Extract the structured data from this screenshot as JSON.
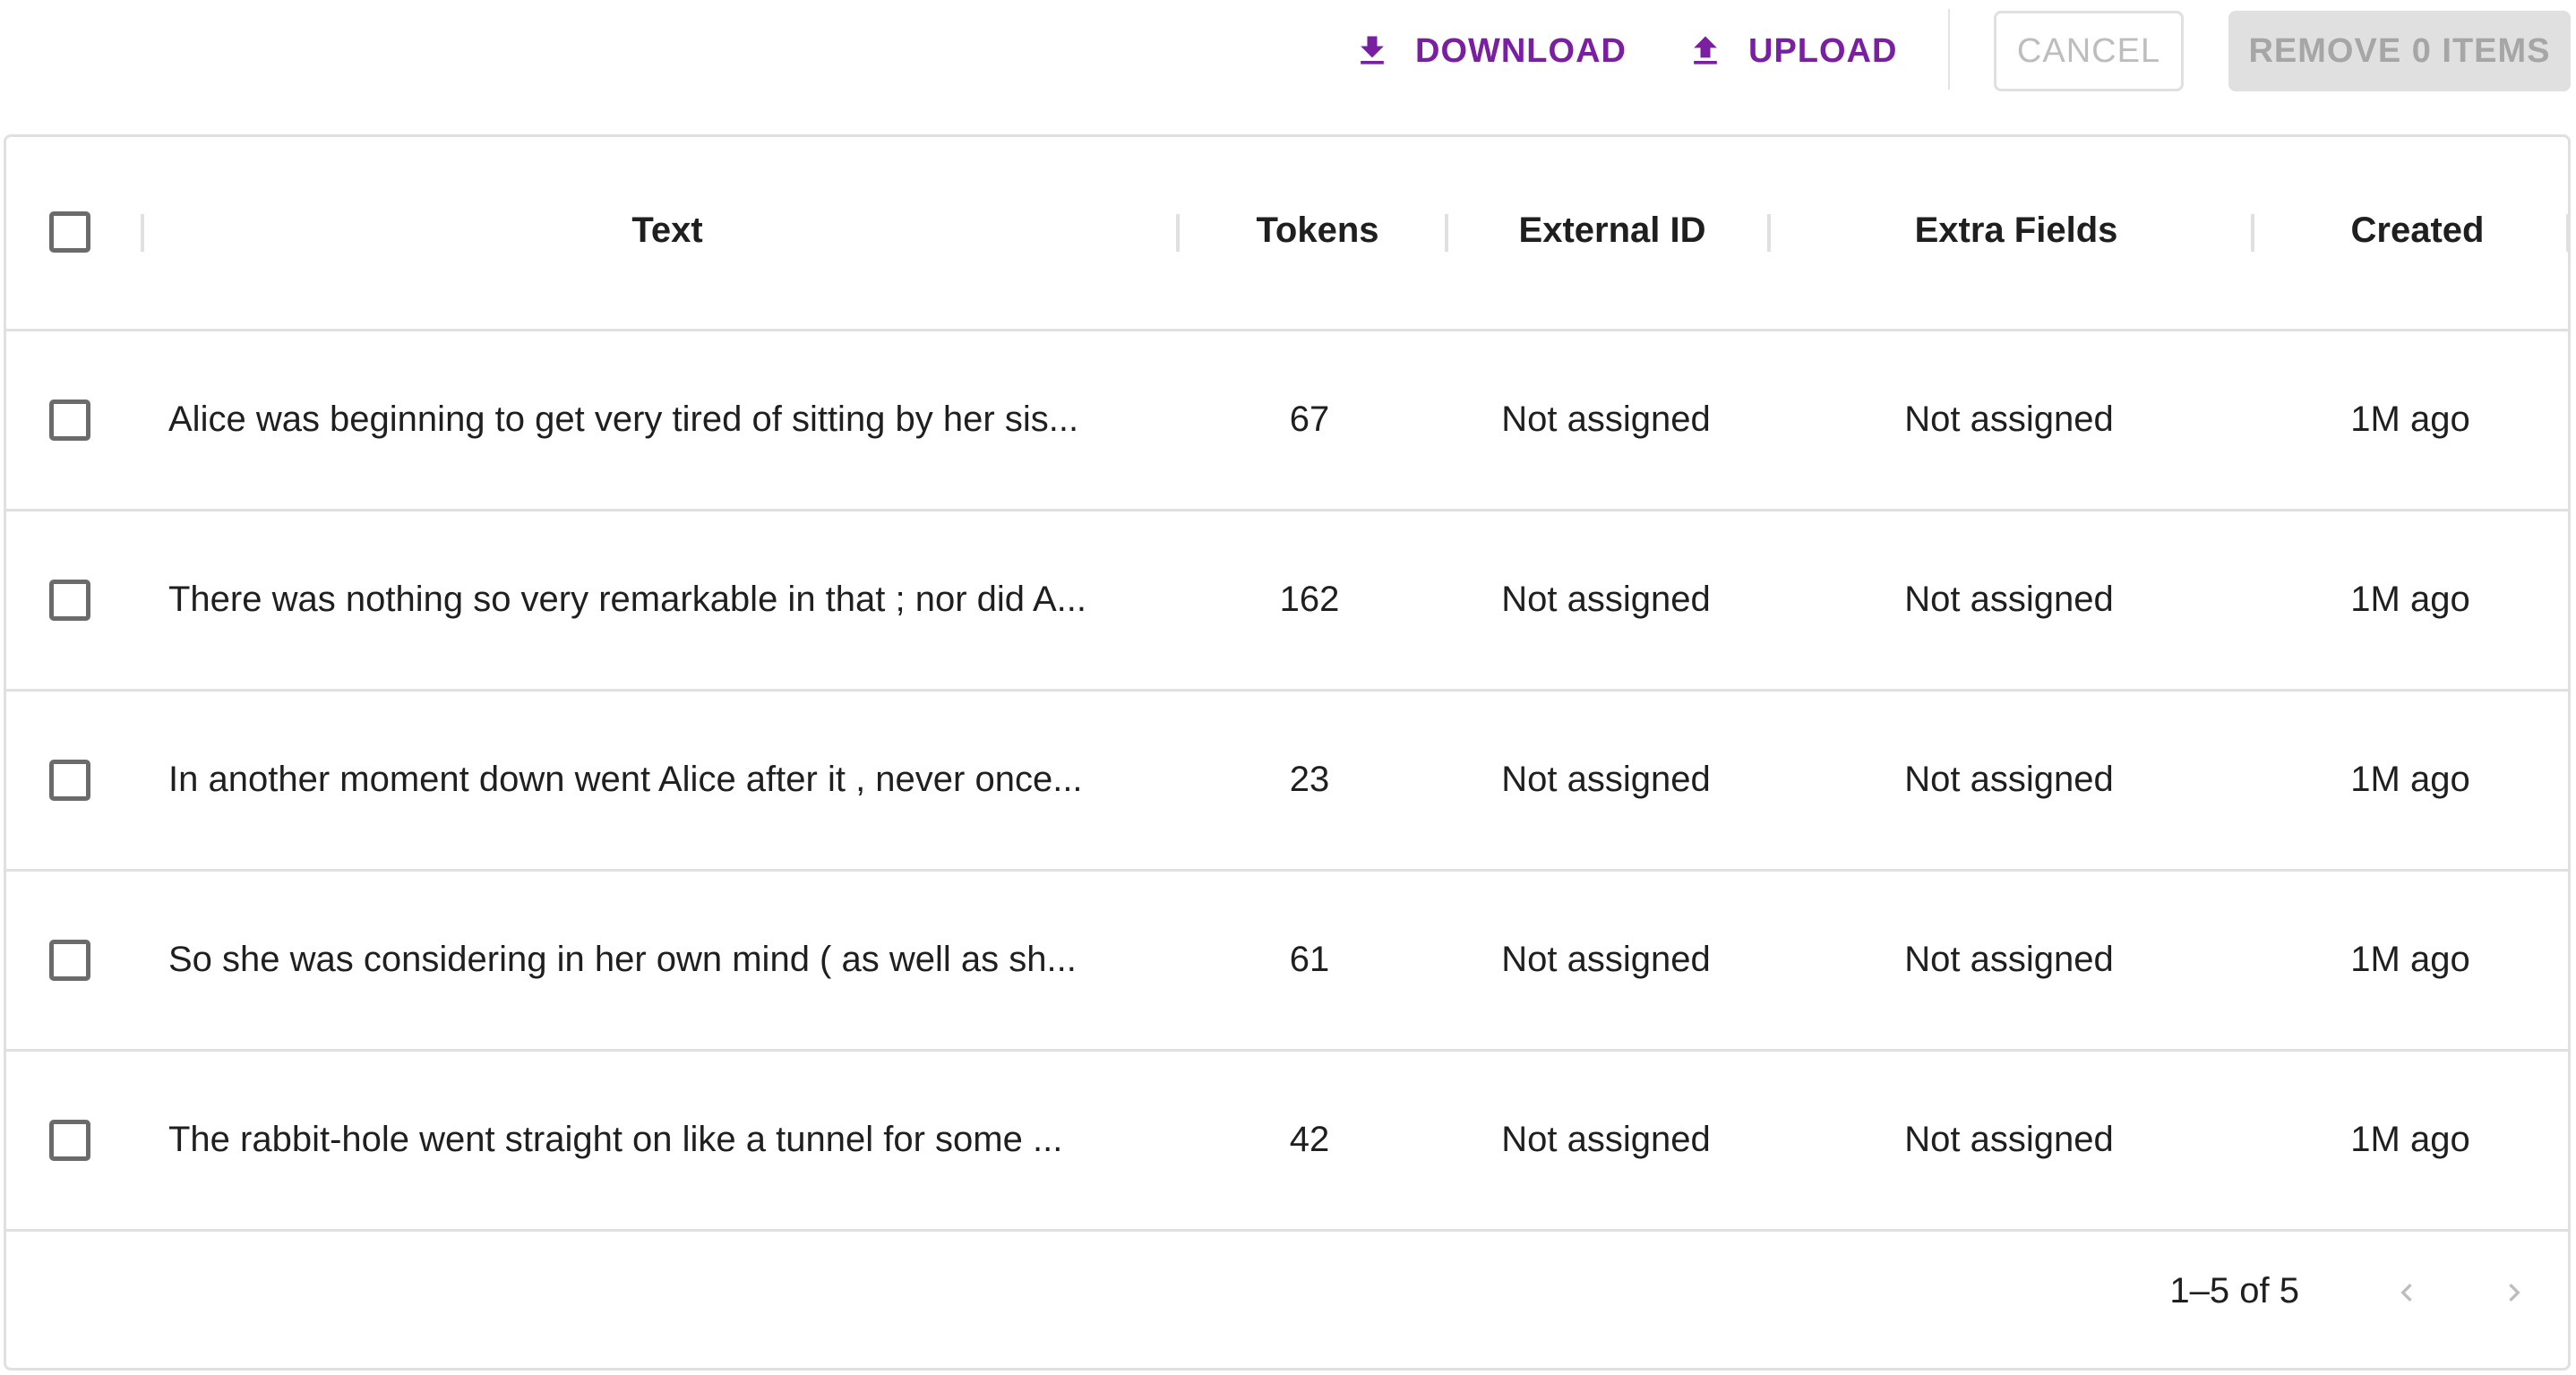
{
  "toolbar": {
    "download_label": "DOWNLOAD",
    "upload_label": "UPLOAD",
    "cancel_label": "CANCEL",
    "remove_label": "REMOVE 0 ITEMS",
    "download_icon": "download-icon",
    "upload_icon": "upload-icon",
    "accent_color": "#7b1fa2"
  },
  "table": {
    "columns": [
      "Text",
      "Tokens",
      "External ID",
      "Extra Fields",
      "Created"
    ],
    "rows": [
      {
        "text": "Alice was beginning to get very tired of sitting by her sis...",
        "tokens": "67",
        "external_id": "Not assigned",
        "extra_fields": "Not assigned",
        "created": "1M ago"
      },
      {
        "text": "There was nothing so very remarkable in that ; nor did A...",
        "tokens": "162",
        "external_id": "Not assigned",
        "extra_fields": "Not assigned",
        "created": "1M ago"
      },
      {
        "text": "In another moment down went Alice after it , never once...",
        "tokens": "23",
        "external_id": "Not assigned",
        "extra_fields": "Not assigned",
        "created": "1M ago"
      },
      {
        "text": "So she was considering in her own mind ( as well as sh...",
        "tokens": "61",
        "external_id": "Not assigned",
        "extra_fields": "Not assigned",
        "created": "1M ago"
      },
      {
        "text": "The rabbit-hole went straight on like a tunnel for some ...",
        "tokens": "42",
        "external_id": "Not assigned",
        "extra_fields": "Not assigned",
        "created": "1M ago"
      }
    ]
  },
  "pagination": {
    "range_label": "1–5 of 5",
    "prev_icon": "chevron-left-icon",
    "next_icon": "chevron-right-icon"
  }
}
